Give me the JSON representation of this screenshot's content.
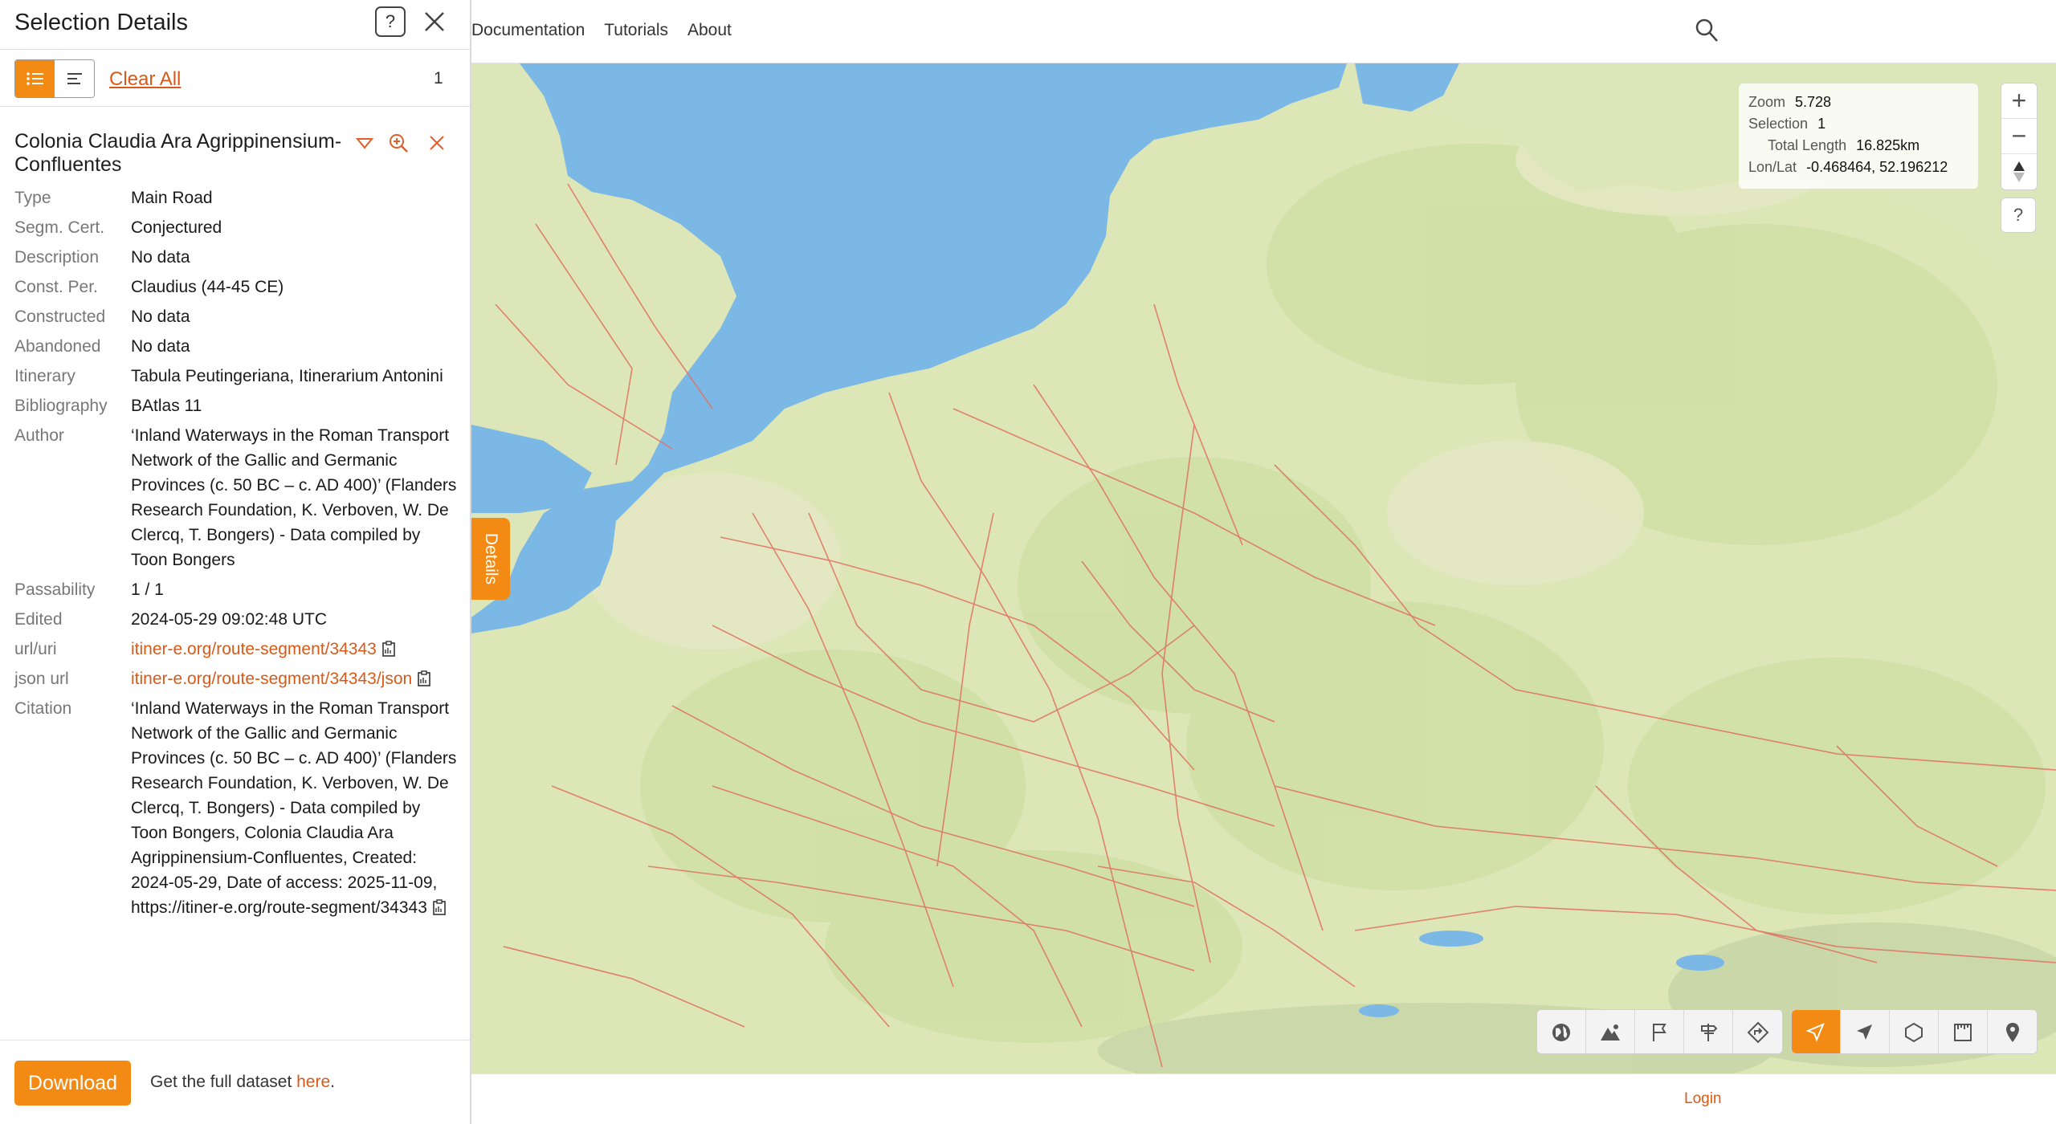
{
  "nav": {
    "items": [
      "Documentation",
      "Tutorials",
      "About"
    ]
  },
  "panel": {
    "title": "Selection Details",
    "help_label": "?",
    "clear_all": "Clear All",
    "count": "1",
    "item": {
      "title": "Colonia Claudia Ara Agrippinensium-Confluentes",
      "properties": [
        {
          "key": "Type",
          "value": "Main Road"
        },
        {
          "key": "Segm. Cert.",
          "value": "Conjectured"
        },
        {
          "key": "Description",
          "value": "No data"
        },
        {
          "key": "Const. Per.",
          "value": "Claudius (44-45 CE)"
        },
        {
          "key": "Constructed",
          "value": "No data"
        },
        {
          "key": "Abandoned",
          "value": "No data"
        },
        {
          "key": "Itinerary",
          "value": "Tabula Peutingeriana, Itinerarium Antonini"
        },
        {
          "key": "Bibliography",
          "value": "BAtlas 11"
        },
        {
          "key": "Author",
          "value": "‘Inland Waterways in the Roman Transport Network of the Gallic and Germanic Provinces (c. 50 BC – c. AD 400)’ (Flanders Research Foundation, K. Verboven, W. De Clercq, T. Bongers) - Data compiled by Toon Bongers"
        },
        {
          "key": "Passability",
          "value": "1 / 1"
        },
        {
          "key": "Edited",
          "value": "2024-05-29 09:02:48 UTC"
        }
      ],
      "url_key": "url/uri",
      "url_value": "itiner-e.org/route-segment/34343",
      "json_key": "json url",
      "json_value": "itiner-e.org/route-segment/34343/json",
      "citation_key": "Citation",
      "citation_value": "‘Inland Waterways in the Roman Transport Network of the Gallic and Germanic Provinces (c. 50 BC – c. AD 400)’ (Flanders Research Foundation, K. Verboven, W. De Clercq, T. Bongers) - Data compiled by Toon Bongers, Colonia Claudia Ara Agrippinensium-Confluentes, Created: 2024-05-29, Date of access: 2025-11-09, https://itiner-e.org/route-segment/34343"
    },
    "download": "Download",
    "footer_text": "Get the full dataset ",
    "footer_link": "here",
    "footer_end": "."
  },
  "map": {
    "details_tab": "Details",
    "info": {
      "zoom_label": "Zoom",
      "zoom_value": "5.728",
      "selection_label": "Selection",
      "selection_value": "1",
      "length_label": "Total Length",
      "length_value": "16.825km",
      "lonlat_label": "Lon/Lat",
      "lonlat_value": "-0.468464, 52.196212"
    },
    "zoom_in": "+",
    "zoom_out": "−",
    "help": "?",
    "colors": {
      "sea": "#7bb8e6",
      "land": "#dce6b6",
      "roads": "#e0705e",
      "accent": "#f28a14",
      "link": "#d95a18"
    },
    "toolbar_icons": [
      "globe-icon",
      "terrain-icon",
      "flag-icon",
      "signpost-icon",
      "route-diamond-icon",
      "select-arrow-icon",
      "navigate-arrow-icon",
      "polygon-icon",
      "ruler-icon",
      "location-pin-icon"
    ]
  },
  "footer": {
    "login": "Login"
  }
}
